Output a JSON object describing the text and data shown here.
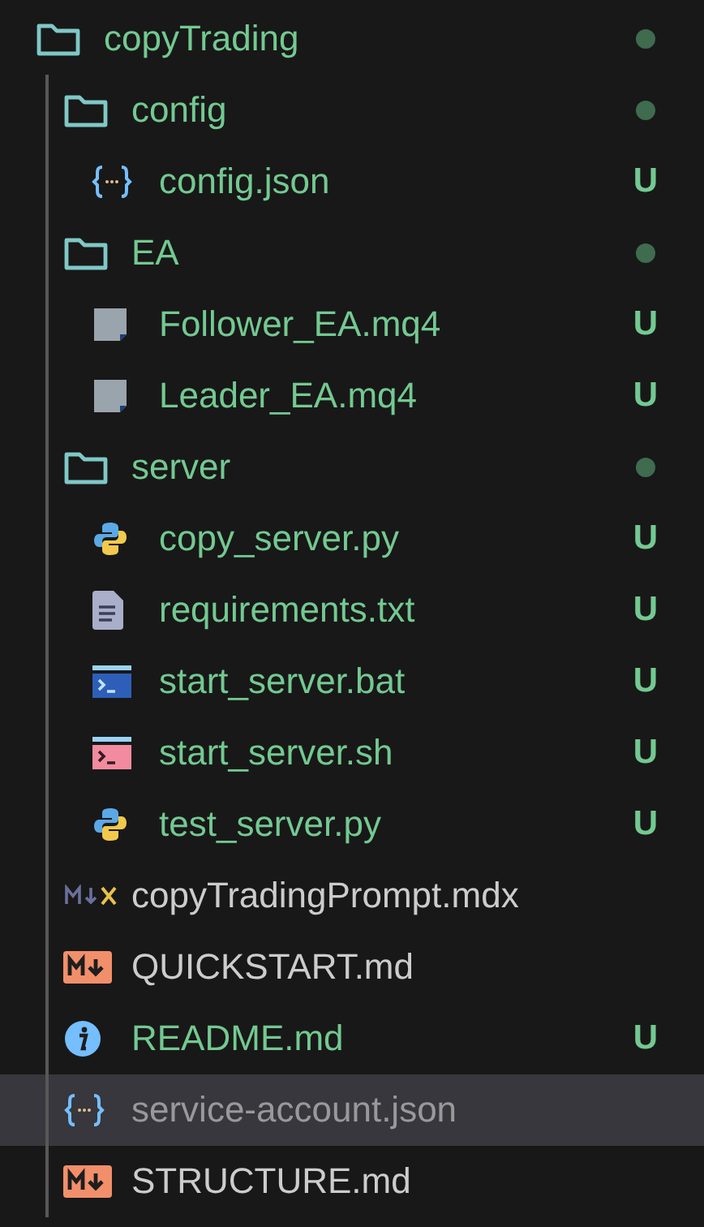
{
  "tree": [
    {
      "name": "copyTrading",
      "kind": "folder",
      "untracked": true,
      "ignored": false,
      "modified": true,
      "selected": false,
      "children": [
        {
          "name": "config",
          "kind": "folder",
          "untracked": true,
          "ignored": false,
          "modified": true,
          "selected": false,
          "children": [
            {
              "name": "config.json",
              "kind": "json",
              "untracked": true,
              "ignored": false,
              "badge": "U",
              "selected": false
            }
          ]
        },
        {
          "name": "EA",
          "kind": "folder",
          "untracked": true,
          "ignored": false,
          "modified": true,
          "selected": false,
          "children": [
            {
              "name": "Follower_EA.mq4",
              "kind": "mq4",
              "untracked": true,
              "ignored": false,
              "badge": "U",
              "selected": false
            },
            {
              "name": "Leader_EA.mq4",
              "kind": "mq4",
              "untracked": true,
              "ignored": false,
              "badge": "U",
              "selected": false
            }
          ]
        },
        {
          "name": "server",
          "kind": "folder",
          "untracked": true,
          "ignored": false,
          "modified": true,
          "selected": false,
          "children": [
            {
              "name": "copy_server.py",
              "kind": "python",
              "untracked": true,
              "ignored": false,
              "badge": "U",
              "selected": false
            },
            {
              "name": "requirements.txt",
              "kind": "text",
              "untracked": true,
              "ignored": false,
              "badge": "U",
              "selected": false
            },
            {
              "name": "start_server.bat",
              "kind": "bat",
              "untracked": true,
              "ignored": false,
              "badge": "U",
              "selected": false
            },
            {
              "name": "start_server.sh",
              "kind": "sh",
              "untracked": true,
              "ignored": false,
              "badge": "U",
              "selected": false
            },
            {
              "name": "test_server.py",
              "kind": "python",
              "untracked": true,
              "ignored": false,
              "badge": "U",
              "selected": false
            }
          ]
        },
        {
          "name": "copyTradingPrompt.mdx",
          "kind": "mdx",
          "untracked": false,
          "ignored": false,
          "selected": false
        },
        {
          "name": "QUICKSTART.md",
          "kind": "md",
          "untracked": false,
          "ignored": false,
          "selected": false
        },
        {
          "name": "README.md",
          "kind": "info",
          "untracked": true,
          "ignored": false,
          "badge": "U",
          "selected": false
        },
        {
          "name": "service-account.json",
          "kind": "json",
          "untracked": false,
          "ignored": true,
          "selected": true
        },
        {
          "name": "STRUCTURE.md",
          "kind": "md",
          "untracked": false,
          "ignored": false,
          "selected": false
        }
      ]
    }
  ]
}
